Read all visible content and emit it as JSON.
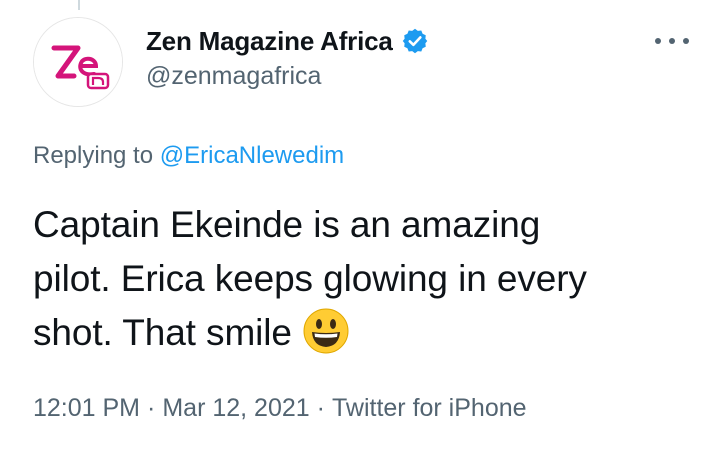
{
  "author": {
    "display_name": "Zen Magazine Africa",
    "handle": "@zenmagafrica",
    "verified": true,
    "avatar_logo_text": "Zen"
  },
  "reply": {
    "prefix": "Replying to",
    "mention": "@EricaNlewedim"
  },
  "tweet": {
    "lines": [
      "Captain Ekeinde is an amazing",
      "pilot. Erica keeps glowing in every",
      "shot. That smile"
    ],
    "emoji": "grinning-face-emoji"
  },
  "meta": {
    "time": "12:01 PM",
    "separator": "·",
    "date": "Mar 12, 2021",
    "source": "Twitter for iPhone"
  },
  "colors": {
    "verified_blue": "#1d9bf0",
    "secondary_text": "#536471",
    "logo_magenta": "#d4147a",
    "emoji_yellow": "#ffcc33"
  }
}
